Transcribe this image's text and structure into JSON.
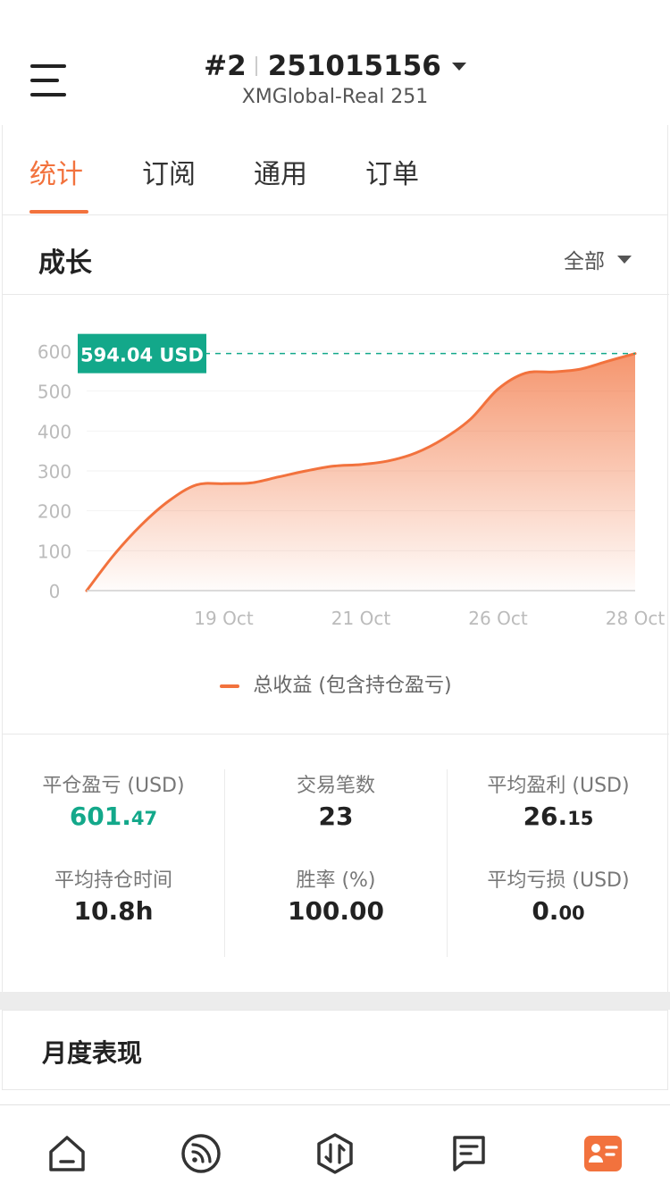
{
  "header": {
    "account_index": "#2",
    "account_number": "251015156",
    "server": "XMGlobal-Real 251"
  },
  "tabs": [
    {
      "label": "统计",
      "active": true
    },
    {
      "label": "订阅",
      "active": false
    },
    {
      "label": "通用",
      "active": false
    },
    {
      "label": "订单",
      "active": false
    }
  ],
  "growth": {
    "title": "成长",
    "filter": "全部"
  },
  "chart_data": {
    "type": "area",
    "current_value_label": "594.04 USD",
    "x_tick_labels": [
      "19 Oct",
      "21 Oct",
      "26 Oct",
      "28 Oct"
    ],
    "y_ticks": [
      0,
      100,
      200,
      300,
      400,
      500,
      600
    ],
    "ylim": [
      0,
      600
    ],
    "grid": true,
    "legend_position": "bottom",
    "series": [
      {
        "name": "总收益 (包含持仓盈亏)",
        "color": "#f2723d",
        "values": [
          0,
          90,
          165,
          225,
          265,
          268,
          270,
          285,
          300,
          312,
          316,
          325,
          345,
          380,
          430,
          505,
          545,
          548,
          555,
          575,
          594.04
        ]
      }
    ]
  },
  "stats": {
    "closed_pl_label": "平仓盈亏 (USD)",
    "closed_pl_int": "601.",
    "closed_pl_dec": "47",
    "trades_label": "交易笔数",
    "trades_value": "23",
    "avg_profit_label": "平均盈利 (USD)",
    "avg_profit_int": "26.",
    "avg_profit_dec": "15",
    "avg_hold_label": "平均持仓时间",
    "avg_hold_value": "10.8h",
    "winrate_label": "胜率 (%)",
    "winrate_value": "100.00",
    "avg_loss_label": "平均亏损 (USD)",
    "avg_loss_int": "0.",
    "avg_loss_dec": "00"
  },
  "monthly": {
    "title": "月度表现"
  },
  "bottom_nav": [
    {
      "icon": "home-icon",
      "active": false
    },
    {
      "icon": "signal-feed-icon",
      "active": false
    },
    {
      "icon": "trade-icon",
      "active": false
    },
    {
      "icon": "news-icon",
      "active": false
    },
    {
      "icon": "account-card-icon",
      "active": true
    }
  ],
  "colors": {
    "accent": "#f2723d",
    "profit_green": "#13a88a"
  }
}
